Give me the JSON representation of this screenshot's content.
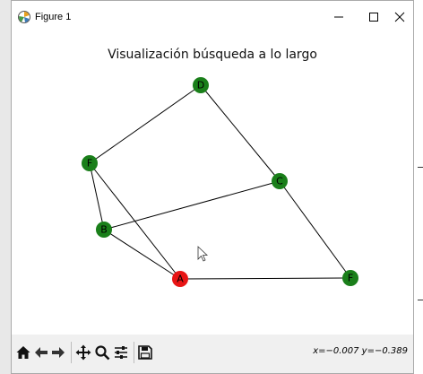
{
  "window": {
    "title": "Figure 1",
    "controls": {
      "minimize": "minimize",
      "maximize": "maximize",
      "close": "close"
    }
  },
  "figure": {
    "title": "Visualización búsqueda a lo largo",
    "colors": {
      "visited": "#1a7f1a",
      "current": "#e81515",
      "edge": "#000000"
    },
    "nodes": [
      {
        "id": "D",
        "label": "D",
        "color": "#1a7f1a"
      },
      {
        "id": "F1",
        "label": "F",
        "color": "#1a7f1a"
      },
      {
        "id": "C",
        "label": "C",
        "color": "#1a7f1a"
      },
      {
        "id": "B",
        "label": "B",
        "color": "#1a7f1a"
      },
      {
        "id": "A",
        "label": "A",
        "color": "#e81515"
      },
      {
        "id": "F2",
        "label": "F",
        "color": "#1a7f1a"
      }
    ],
    "edges": [
      [
        "D",
        "F1"
      ],
      [
        "D",
        "C"
      ],
      [
        "F1",
        "B"
      ],
      [
        "F1",
        "A"
      ],
      [
        "B",
        "C"
      ],
      [
        "B",
        "A"
      ],
      [
        "C",
        "F2"
      ],
      [
        "A",
        "F2"
      ]
    ]
  },
  "toolbar": {
    "buttons": [
      "home-icon",
      "back-arrow-icon",
      "forward-arrow-icon",
      "pan-icon",
      "zoom-icon",
      "configure-subplots-icon",
      "save-icon"
    ],
    "coordinates": "x=−0.007 y=−0.389"
  }
}
